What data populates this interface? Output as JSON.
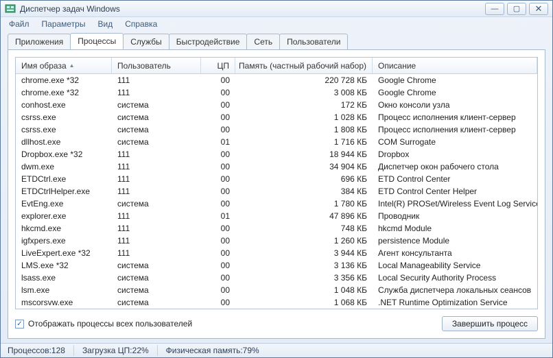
{
  "window": {
    "title": "Диспетчер задач Windows"
  },
  "menu": {
    "file": "Файл",
    "options": "Параметры",
    "view": "Вид",
    "help": "Справка"
  },
  "tabs": {
    "apps": "Приложения",
    "processes": "Процессы",
    "services": "Службы",
    "performance": "Быстродействие",
    "network": "Сеть",
    "users": "Пользователи"
  },
  "columns": {
    "image": "Имя образа",
    "user": "Пользователь",
    "cpu": "ЦП",
    "mem": "Память (частный рабочий набор)",
    "desc": "Описание"
  },
  "rows": [
    {
      "image": "chrome.exe *32",
      "user": "111",
      "cpu": "00",
      "mem": "220 728 КБ",
      "desc": "Google Chrome"
    },
    {
      "image": "chrome.exe *32",
      "user": "111",
      "cpu": "00",
      "mem": "3 008 КБ",
      "desc": "Google Chrome"
    },
    {
      "image": "conhost.exe",
      "user": "система",
      "cpu": "00",
      "mem": "172 КБ",
      "desc": "Окно консоли узла"
    },
    {
      "image": "csrss.exe",
      "user": "система",
      "cpu": "00",
      "mem": "1 028 КБ",
      "desc": "Процесс исполнения клиент-сервер"
    },
    {
      "image": "csrss.exe",
      "user": "система",
      "cpu": "00",
      "mem": "1 808 КБ",
      "desc": "Процесс исполнения клиент-сервер"
    },
    {
      "image": "dllhost.exe",
      "user": "система",
      "cpu": "01",
      "mem": "1 716 КБ",
      "desc": "COM Surrogate"
    },
    {
      "image": "Dropbox.exe *32",
      "user": "111",
      "cpu": "00",
      "mem": "18 944 КБ",
      "desc": "Dropbox"
    },
    {
      "image": "dwm.exe",
      "user": "111",
      "cpu": "00",
      "mem": "34 904 КБ",
      "desc": "Диспетчер окон рабочего стола"
    },
    {
      "image": "ETDCtrl.exe",
      "user": "111",
      "cpu": "00",
      "mem": "696 КБ",
      "desc": "ETD Control Center"
    },
    {
      "image": "ETDCtrlHelper.exe",
      "user": "111",
      "cpu": "00",
      "mem": "384 КБ",
      "desc": "ETD Control Center Helper"
    },
    {
      "image": "EvtEng.exe",
      "user": "система",
      "cpu": "00",
      "mem": "1 780 КБ",
      "desc": "Intel(R) PROSet/Wireless Event Log Service"
    },
    {
      "image": "explorer.exe",
      "user": "111",
      "cpu": "01",
      "mem": "47 896 КБ",
      "desc": "Проводник"
    },
    {
      "image": "hkcmd.exe",
      "user": "111",
      "cpu": "00",
      "mem": "748 КБ",
      "desc": "hkcmd Module"
    },
    {
      "image": "igfxpers.exe",
      "user": "111",
      "cpu": "00",
      "mem": "1 260 КБ",
      "desc": "persistence Module"
    },
    {
      "image": "LiveExpert.exe *32",
      "user": "111",
      "cpu": "00",
      "mem": "3 944 КБ",
      "desc": "Агент консультанта"
    },
    {
      "image": "LMS.exe *32",
      "user": "система",
      "cpu": "00",
      "mem": "3 136 КБ",
      "desc": "Local Manageability Service"
    },
    {
      "image": "lsass.exe",
      "user": "система",
      "cpu": "00",
      "mem": "3 356 КБ",
      "desc": "Local Security Authority Process"
    },
    {
      "image": "lsm.exe",
      "user": "система",
      "cpu": "00",
      "mem": "1 048 КБ",
      "desc": "Служба диспетчера локальных сеансов"
    },
    {
      "image": "mscorsvw.exe",
      "user": "система",
      "cpu": "00",
      "mem": "1 068 КБ",
      "desc": ".NET Runtime Optimization Service"
    }
  ],
  "bottom": {
    "checkbox_label": "Отображать процессы всех пользователей",
    "checkbox_checked": "✓",
    "end_process": "Завершить процесс"
  },
  "status": {
    "procs_label": "Процессов: ",
    "procs_val": "128",
    "cpu_label": "Загрузка ЦП: ",
    "cpu_val": "22%",
    "mem_label": "Физическая память: ",
    "mem_val": "79%"
  }
}
